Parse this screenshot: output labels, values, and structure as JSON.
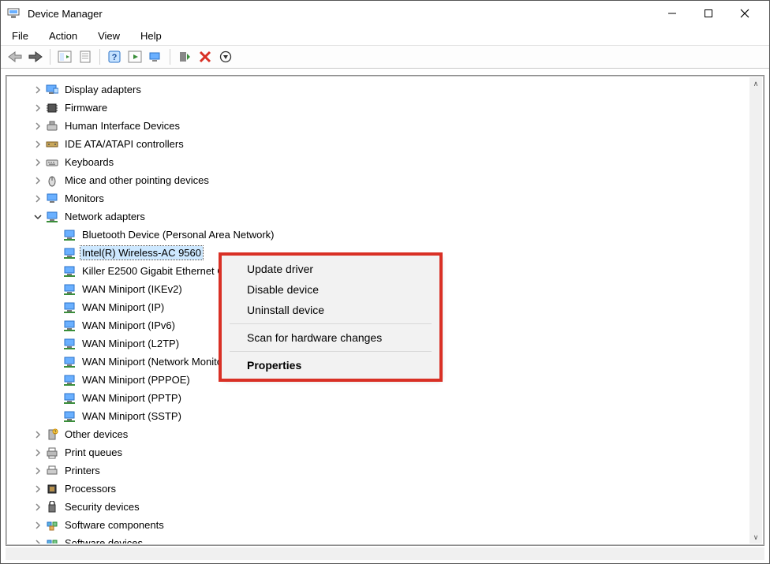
{
  "window": {
    "title": "Device Manager"
  },
  "menu": {
    "file": "File",
    "action": "Action",
    "view": "View",
    "help": "Help"
  },
  "toolbar_icons": {
    "back": "back-arrow-icon",
    "forward": "forward-arrow-icon",
    "show_hide": "show-hide-console-tree-icon",
    "properties": "properties-sheet-icon",
    "help": "help-icon",
    "action1": "action-icon",
    "monitor": "monitor-toggle-icon",
    "enable": "enable-device-icon",
    "disable": "disable-device-icon",
    "scan": "scan-hardware-icon"
  },
  "tree": {
    "items": [
      {
        "depth": 1,
        "exp": "col",
        "icon": "display",
        "label": "Display adapters"
      },
      {
        "depth": 1,
        "exp": "col",
        "icon": "firmware",
        "label": "Firmware"
      },
      {
        "depth": 1,
        "exp": "col",
        "icon": "hid",
        "label": "Human Interface Devices"
      },
      {
        "depth": 1,
        "exp": "col",
        "icon": "ide",
        "label": "IDE ATA/ATAPI controllers"
      },
      {
        "depth": 1,
        "exp": "col",
        "icon": "keyboard",
        "label": "Keyboards"
      },
      {
        "depth": 1,
        "exp": "col",
        "icon": "mouse",
        "label": "Mice and other pointing devices"
      },
      {
        "depth": 1,
        "exp": "col",
        "icon": "monitor",
        "label": "Monitors"
      },
      {
        "depth": 1,
        "exp": "exp",
        "icon": "network",
        "label": "Network adapters"
      },
      {
        "depth": 2,
        "exp": "none",
        "icon": "network",
        "label": "Bluetooth Device (Personal Area Network)"
      },
      {
        "depth": 2,
        "exp": "none",
        "icon": "network",
        "label": "Intel(R) Wireless-AC 9560",
        "selected": true
      },
      {
        "depth": 2,
        "exp": "none",
        "icon": "network",
        "label": "Killer E2500 Gigabit Ethernet Controller"
      },
      {
        "depth": 2,
        "exp": "none",
        "icon": "network",
        "label": "WAN Miniport (IKEv2)"
      },
      {
        "depth": 2,
        "exp": "none",
        "icon": "network",
        "label": "WAN Miniport (IP)"
      },
      {
        "depth": 2,
        "exp": "none",
        "icon": "network",
        "label": "WAN Miniport (IPv6)"
      },
      {
        "depth": 2,
        "exp": "none",
        "icon": "network",
        "label": "WAN Miniport (L2TP)"
      },
      {
        "depth": 2,
        "exp": "none",
        "icon": "network",
        "label": "WAN Miniport (Network Monitor)"
      },
      {
        "depth": 2,
        "exp": "none",
        "icon": "network",
        "label": "WAN Miniport (PPPOE)"
      },
      {
        "depth": 2,
        "exp": "none",
        "icon": "network",
        "label": "WAN Miniport (PPTP)"
      },
      {
        "depth": 2,
        "exp": "none",
        "icon": "network",
        "label": "WAN Miniport (SSTP)"
      },
      {
        "depth": 1,
        "exp": "col",
        "icon": "other",
        "label": "Other devices"
      },
      {
        "depth": 1,
        "exp": "col",
        "icon": "printq",
        "label": "Print queues"
      },
      {
        "depth": 1,
        "exp": "col",
        "icon": "printer",
        "label": "Printers"
      },
      {
        "depth": 1,
        "exp": "col",
        "icon": "cpu",
        "label": "Processors"
      },
      {
        "depth": 1,
        "exp": "col",
        "icon": "security",
        "label": "Security devices"
      },
      {
        "depth": 1,
        "exp": "col",
        "icon": "component",
        "label": "Software components"
      },
      {
        "depth": 1,
        "exp": "col",
        "icon": "component",
        "label": "Software devices"
      }
    ]
  },
  "context_menu": {
    "update": "Update driver",
    "disable": "Disable device",
    "uninstall": "Uninstall device",
    "scan": "Scan for hardware changes",
    "props": "Properties"
  }
}
